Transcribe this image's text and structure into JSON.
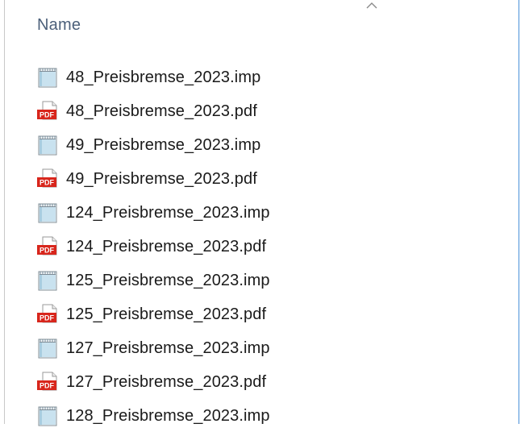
{
  "header": {
    "column_name": "Name"
  },
  "files": [
    {
      "name": "48_Preisbremse_2023.imp",
      "icon": "text-document-icon"
    },
    {
      "name": "48_Preisbremse_2023.pdf",
      "icon": "pdf-icon"
    },
    {
      "name": "49_Preisbremse_2023.imp",
      "icon": "text-document-icon"
    },
    {
      "name": "49_Preisbremse_2023.pdf",
      "icon": "pdf-icon"
    },
    {
      "name": "124_Preisbremse_2023.imp",
      "icon": "text-document-icon"
    },
    {
      "name": "124_Preisbremse_2023.pdf",
      "icon": "pdf-icon"
    },
    {
      "name": "125_Preisbremse_2023.imp",
      "icon": "text-document-icon"
    },
    {
      "name": "125_Preisbremse_2023.pdf",
      "icon": "pdf-icon"
    },
    {
      "name": "127_Preisbremse_2023.imp",
      "icon": "text-document-icon"
    },
    {
      "name": "127_Preisbremse_2023.pdf",
      "icon": "pdf-icon"
    },
    {
      "name": "128_Preisbremse_2023.imp",
      "icon": "text-document-icon"
    }
  ],
  "pdf_badge_text": "PDF",
  "colors": {
    "header_text": "#4c607a",
    "pdf_red": "#d8261c",
    "accent_border": "#4a90d9"
  }
}
